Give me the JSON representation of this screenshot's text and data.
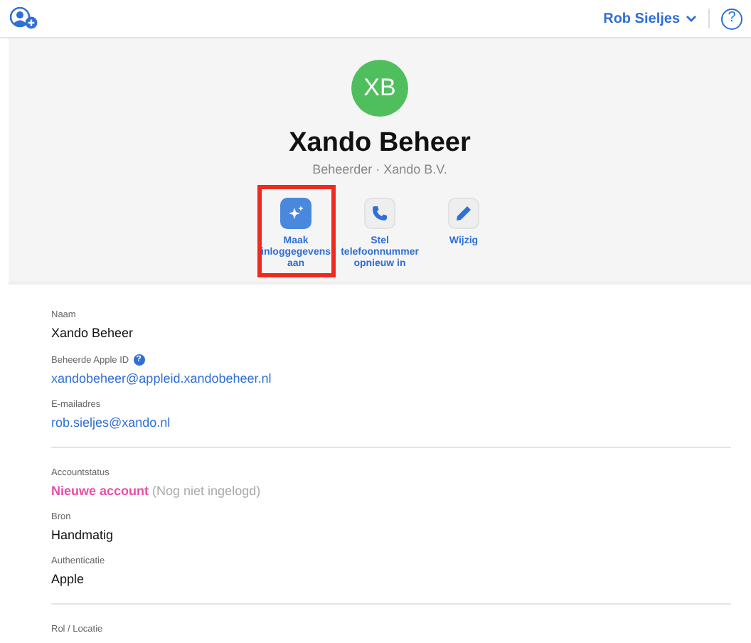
{
  "topbar": {
    "user": "Rob Sieljes",
    "help": "?"
  },
  "profile": {
    "initials": "XB",
    "name": "Xando Beheer",
    "subtitle": "Beheerder · Xando B.V."
  },
  "actions": [
    {
      "label": "Maak inloggegevens aan",
      "kind": "sparkle",
      "primary": true,
      "highlighted": true
    },
    {
      "label": "Stel telefoonnummer opnieuw in",
      "kind": "phone",
      "primary": false,
      "highlighted": false
    },
    {
      "label": "Wijzig",
      "kind": "pencil",
      "primary": false,
      "highlighted": false
    }
  ],
  "sections": [
    {
      "fields": [
        {
          "label": "Naam",
          "value": "Xando Beheer",
          "kind": "text"
        },
        {
          "label": "Beheerde Apple ID",
          "value": "xandobeheer@appleid.xandobeheer.nl",
          "kind": "link",
          "help": "?"
        },
        {
          "label": "E-mailadres",
          "value": "rob.sieljes@xando.nl",
          "kind": "link"
        }
      ]
    },
    {
      "fields": [
        {
          "label": "Accountstatus",
          "value": "Nieuwe account",
          "note": "(Nog niet ingelogd)",
          "kind": "status"
        },
        {
          "label": "Bron",
          "value": "Handmatig",
          "kind": "text"
        },
        {
          "label": "Authenticatie",
          "value": "Apple",
          "kind": "text"
        }
      ]
    },
    {
      "fields": [
        {
          "label": "Rol / Locatie",
          "kind": "label-only"
        }
      ]
    }
  ]
}
